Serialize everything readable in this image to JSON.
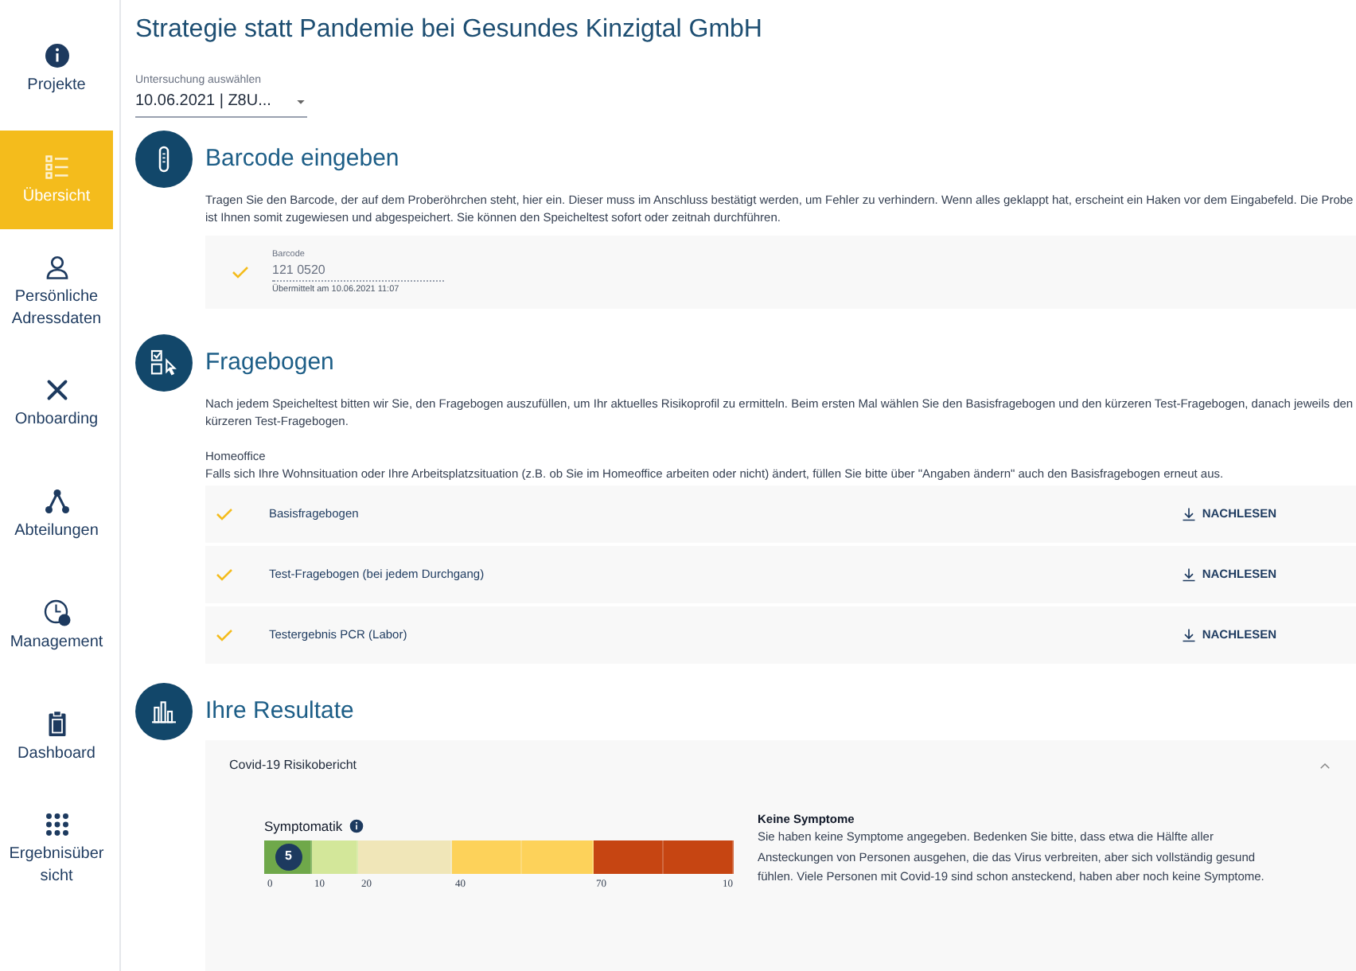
{
  "sidebar": {
    "items": [
      {
        "label": "Projekte",
        "selected": false
      },
      {
        "label": "Übersicht",
        "selected": true
      },
      {
        "label": "Persönliche Adressdaten",
        "selected": false
      },
      {
        "label": "Onboarding",
        "selected": false
      },
      {
        "label": "Abteilungen",
        "selected": false
      },
      {
        "label": "Management",
        "selected": false
      },
      {
        "label": "Dashboard",
        "selected": false
      },
      {
        "label": "Ergebnisübersicht",
        "selected": false
      }
    ]
  },
  "page_title": "Strategie statt Pandemie bei Gesundes Kinzigtal GmbH",
  "exam_select": {
    "label": "Untersuchung auswählen",
    "value": "10.06.2021 | Z8U..."
  },
  "barcode_section": {
    "title": "Barcode eingeben",
    "text": "Tragen Sie den Barcode, der auf dem Proberöhrchen steht, hier ein. Dieser muss im Anschluss bestätigt werden, um Fehler zu verhindern. Wenn alles geklappt hat, erscheint ein Haken vor dem Eingabefeld. Die Probe ist Ihnen somit zugewiesen und abgespeichert. Sie können den Speicheltest sofort oder zeitnah durchführen.",
    "field": {
      "label": "Barcode",
      "value": "121 0520",
      "hint": "Übermittelt am 10.06.2021 11:07",
      "confirmed": true
    }
  },
  "questionnaire_section": {
    "title": "Fragebogen",
    "text": "Nach jedem Speicheltest bitten wir Sie, den Fragebogen auszufüllen, um Ihr aktuelles Risikoprofil zu ermitteln. Beim ersten Mal wählen Sie den Basisfragebogen und den kürzeren Test-Fragebogen, danach jeweils den kürzeren Test-Fragebogen.",
    "note_title": "Homeoffice",
    "note": "Falls sich Ihre Wohnsituation oder Ihre Arbeitsplatzsituation (z.B. ob Sie im Homeoffice arbeiten oder nicht) ändert, füllen Sie bitte über \"Angaben ändern\" auch den Basisfragebogen erneut aus.",
    "rows": [
      {
        "label": "Basisfragebogen",
        "done": true,
        "action": "NACHLESEN"
      },
      {
        "label": "Test-Fragebogen (bei jedem Durchgang)",
        "done": true,
        "action": "NACHLESEN"
      },
      {
        "label": "Testergebnis PCR (Labor)",
        "done": true,
        "action": "NACHLESEN"
      }
    ]
  },
  "results_section": {
    "title": "Ihre Resultate",
    "panel": {
      "title": "Covid-19 Risikobericht",
      "expanded": true,
      "scale": {
        "title": "Symptomatik",
        "marker": "5",
        "level": 0.05,
        "segments": [
          {
            "color": "#6fa84a"
          },
          {
            "color": "#d3e79a"
          },
          {
            "color": "#f0e6b8"
          },
          {
            "color": "#fdd25a"
          },
          {
            "color": "#fdd25a"
          },
          {
            "color": "#c64512"
          },
          {
            "color": "#c64512"
          }
        ],
        "ticks": [
          "0",
          "10",
          "20",
          "40",
          "70",
          "10"
        ]
      },
      "result_title": "Keine Symptome",
      "result_text": "Sie haben keine Symptome angegeben. Bedenken Sie bitte, dass etwa die Hälfte aller Ansteckungen von Personen ausgehen, die das Virus verbreiten, aber sich vollständig gesund fühlen. Viele Personen mit Covid-19 sind schon ansteckend, haben aber noch keine Symptome."
    }
  }
}
